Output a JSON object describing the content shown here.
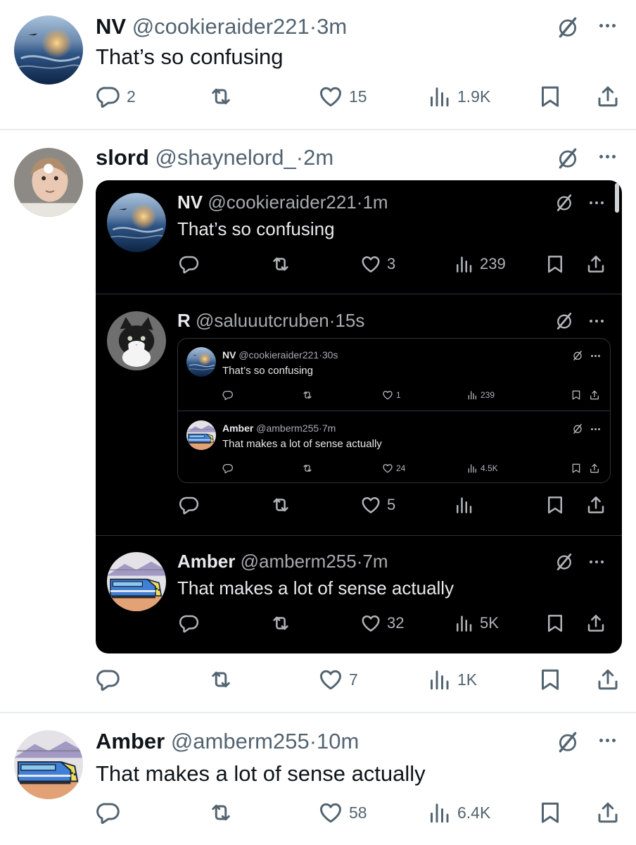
{
  "tweets": [
    {
      "name": "NV",
      "handle": "@cookieraider221",
      "dot": "·",
      "time": "3m",
      "text": "That’s so confusing",
      "avatar": "earth-from-space",
      "replies": "2",
      "reposts": "",
      "likes": "15",
      "views": "1.9K"
    },
    {
      "name": "slord",
      "handle": "@shaynelord_",
      "dot": "·",
      "time": "2m",
      "avatar": "baby-photo",
      "replies": "",
      "reposts": "",
      "likes": "7",
      "views": "1K",
      "embed": {
        "posts": [
          {
            "name": "NV",
            "handle": "@cookieraider221",
            "dot": "·",
            "time": "1m",
            "text": "That’s so confusing",
            "avatar": "earth-from-space",
            "replies": "",
            "reposts": "",
            "likes": "3",
            "views": "239"
          },
          {
            "name": "R",
            "handle": "@saluuutcruben",
            "dot": "·",
            "time": "15s",
            "avatar": "kitten-photo",
            "replies": "",
            "reposts": "",
            "likes": "5",
            "views": "",
            "quote": {
              "posts": [
                {
                  "name": "NV",
                  "handle": "@cookieraider221",
                  "dot": "·",
                  "time": "30s",
                  "text": "That’s so confusing",
                  "avatar": "earth-from-space",
                  "replies": "",
                  "reposts": "",
                  "likes": "1",
                  "views": "239"
                },
                {
                  "name": "Amber",
                  "handle": "@amberm255",
                  "dot": "·",
                  "time": "7m",
                  "text": "That makes a lot of sense actually",
                  "avatar": "cartoon-train",
                  "replies": "",
                  "reposts": "",
                  "likes": "24",
                  "views": "4.5K"
                }
              ]
            }
          },
          {
            "name": "Amber",
            "handle": "@amberm255",
            "dot": "·",
            "time": "7m",
            "text": "That makes a lot of sense actually",
            "avatar": "cartoon-train",
            "replies": "",
            "reposts": "",
            "likes": "32",
            "views": "5K"
          }
        ]
      }
    },
    {
      "name": "Amber",
      "handle": "@amberm255",
      "dot": "·",
      "time": "10m",
      "text": "That makes a lot of sense actually",
      "avatar": "cartoon-train",
      "replies": "",
      "reposts": "",
      "likes": "58",
      "views": "6.4K"
    }
  ],
  "icons": {
    "reply": "reply-icon",
    "repost": "repost-icon",
    "like": "heart-icon",
    "views": "views-icon",
    "bookmark": "bookmark-icon",
    "share": "share-icon",
    "grok": "grok-icon",
    "more": "more-icon"
  },
  "colors": {
    "text": "#0f1419",
    "secondary": "#536471",
    "dark_background": "#000000",
    "dark_text": "#e7e9ea",
    "divider": "#e9ecef"
  }
}
